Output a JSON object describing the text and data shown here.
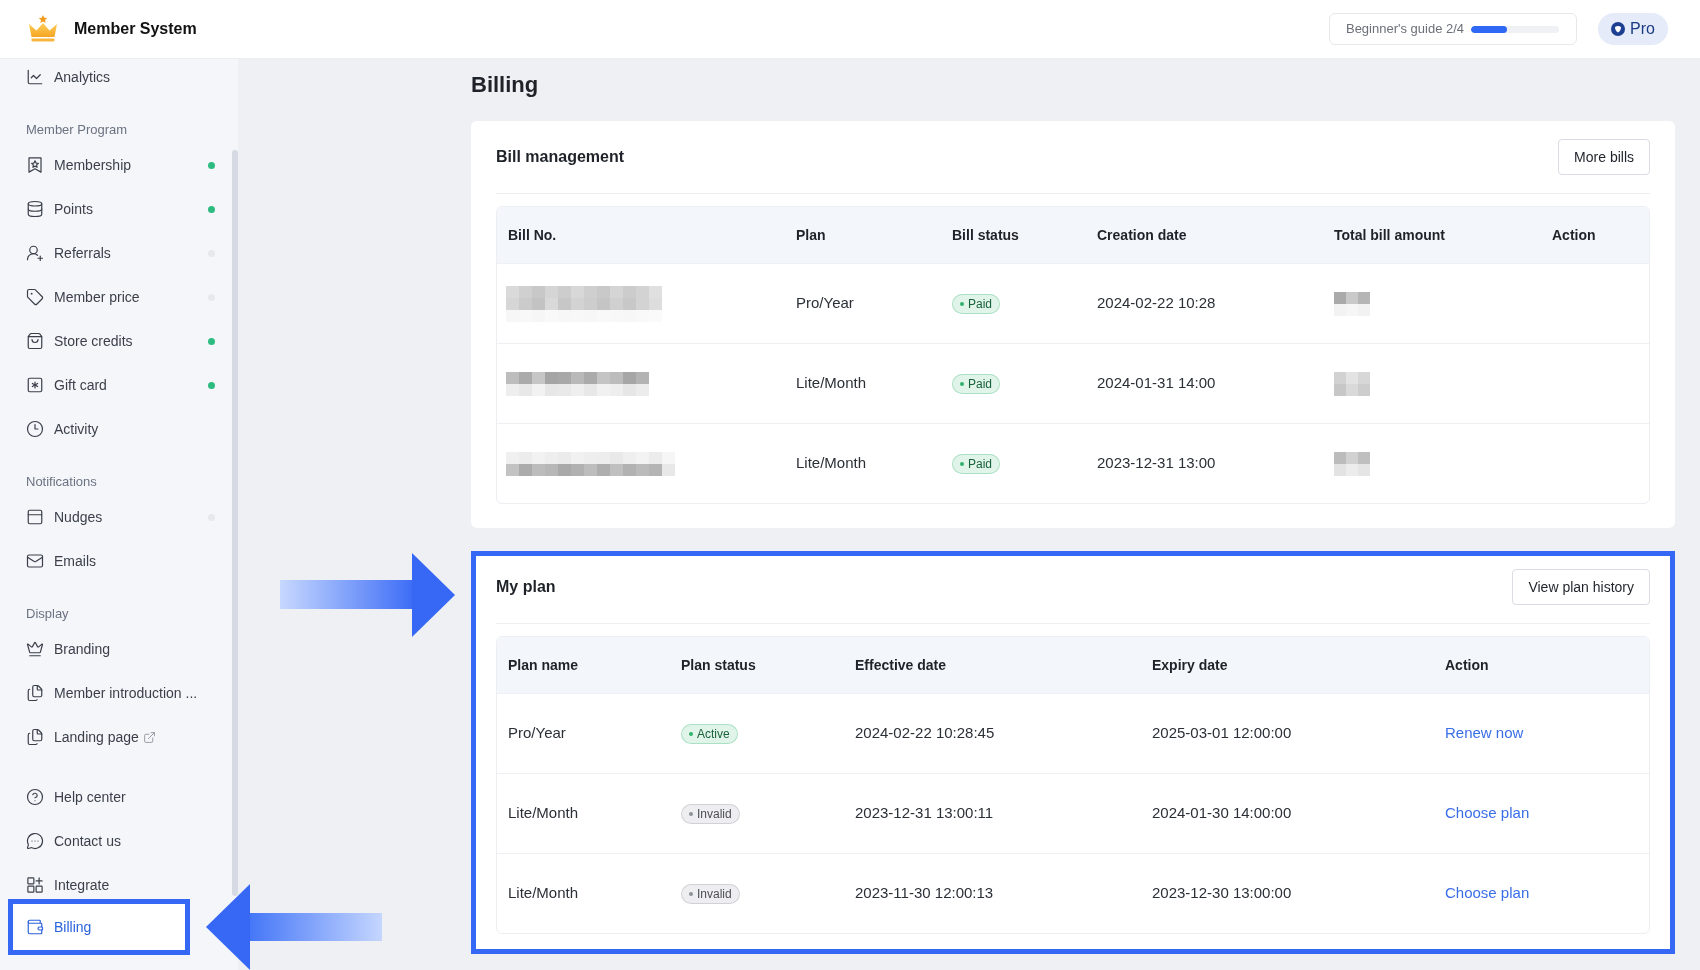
{
  "header": {
    "title": "Member System",
    "guide": {
      "label": "Beginner's guide 2/4",
      "level": 0.41
    },
    "plan_button": "Pro"
  },
  "sidebar": {
    "groups": [
      {
        "items": [
          {
            "label": "Analytics",
            "external": false,
            "selected": false
          }
        ]
      },
      {
        "heading": "Member Program",
        "items": [
          {
            "label": "Membership",
            "color": "#2dbb7f",
            "external": false,
            "selected": false
          },
          {
            "label": "Points",
            "color": "#2dbb7f",
            "external": false,
            "selected": false
          },
          {
            "label": "Referrals",
            "color": "#e6e8ec",
            "external": false,
            "selected": false
          },
          {
            "label": "Member price",
            "color": "#e6e8ec",
            "external": false,
            "selected": false
          },
          {
            "label": "Store credits",
            "color": "#2dbb7f",
            "external": false,
            "selected": false
          },
          {
            "label": "Gift card",
            "color": "#2dbb7f",
            "external": false,
            "selected": false
          },
          {
            "label": "Activity",
            "external": false,
            "selected": false
          }
        ]
      },
      {
        "heading": "Notifications",
        "items": [
          {
            "label": "Nudges",
            "color": "#e6e8ec",
            "external": false,
            "selected": false
          },
          {
            "label": "Emails",
            "external": false,
            "selected": false
          }
        ]
      },
      {
        "heading": "Display",
        "items": [
          {
            "label": "Branding",
            "external": false,
            "selected": false
          },
          {
            "label": "Member introduction ...",
            "external": false,
            "selected": false
          },
          {
            "label": "Landing page",
            "external": true,
            "selected": false
          }
        ]
      },
      {
        "items": [
          {
            "label": "Help center",
            "external": false,
            "selected": false
          },
          {
            "label": "Contact us",
            "external": false,
            "selected": false
          },
          {
            "label": "Integrate",
            "external": false,
            "selected": false
          },
          {
            "label": "Billing",
            "external": false,
            "selected": true
          }
        ]
      }
    ]
  },
  "page": {
    "title": "Billing"
  },
  "bill_management": {
    "title": "Bill management",
    "button": "More bills",
    "columns": [
      "Bill No.",
      "Plan",
      "Bill status",
      "Creation date",
      "Total bill amount",
      "Action"
    ],
    "rows": [
      {
        "plan": "Pro/Year",
        "status": "Paid",
        "color": "#2fb36b",
        "created": "2024-02-22 10:28"
      },
      {
        "plan": "Lite/Month",
        "status": "Paid",
        "color": "#2fb36b",
        "created": "2024-01-31 14:00"
      },
      {
        "plan": "Lite/Month",
        "status": "Paid",
        "color": "#2fb36b",
        "created": "2023-12-31 13:00"
      }
    ]
  },
  "my_plan": {
    "title": "My plan",
    "button": "View plan history",
    "columns": [
      "Plan name",
      "Plan status",
      "Effective date",
      "Expiry date",
      "Action"
    ],
    "rows": [
      {
        "name": "Pro/Year",
        "status": "Active",
        "color": "#2fb36b",
        "effective": "2024-02-22 10:28:45",
        "expiry": "2025-03-01 12:00:00",
        "action": "Renew now"
      },
      {
        "name": "Lite/Month",
        "status": "Invalid",
        "color": "#8c9099",
        "effective": "2023-12-31 13:00:11",
        "expiry": "2024-01-30 14:00:00",
        "action": "Choose plan"
      },
      {
        "name": "Lite/Month",
        "status": "Invalid",
        "color": "#8c9099",
        "effective": "2023-11-30 12:00:13",
        "expiry": "2023-12-30 13:00:00",
        "action": "Choose plan"
      }
    ]
  }
}
